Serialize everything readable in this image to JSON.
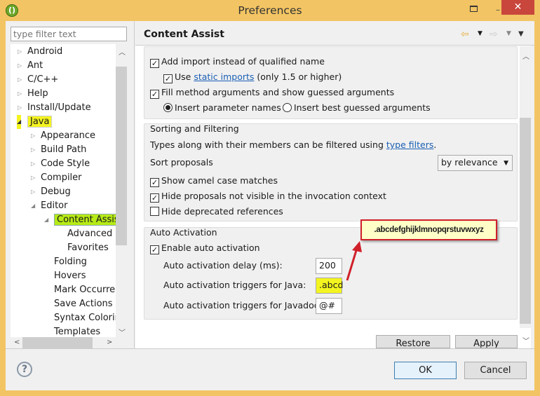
{
  "window": {
    "title": "Preferences",
    "app_icon": "eclipse-icon"
  },
  "filter": {
    "placeholder": "type filter text",
    "value": ""
  },
  "tree": {
    "items": [
      {
        "label": "Android",
        "level": 0,
        "state": "collapsed"
      },
      {
        "label": "Ant",
        "level": 0,
        "state": "collapsed"
      },
      {
        "label": "C/C++",
        "level": 0,
        "state": "collapsed"
      },
      {
        "label": "Help",
        "level": 0,
        "state": "collapsed"
      },
      {
        "label": "Install/Update",
        "level": 0,
        "state": "collapsed"
      },
      {
        "label": "Java",
        "level": 0,
        "state": "expanded",
        "highlight": "yellow"
      },
      {
        "label": "Appearance",
        "level": 1,
        "state": "collapsed"
      },
      {
        "label": "Build Path",
        "level": 1,
        "state": "collapsed"
      },
      {
        "label": "Code Style",
        "level": 1,
        "state": "collapsed"
      },
      {
        "label": "Compiler",
        "level": 1,
        "state": "collapsed"
      },
      {
        "label": "Debug",
        "level": 1,
        "state": "collapsed"
      },
      {
        "label": "Editor",
        "level": 1,
        "state": "expanded"
      },
      {
        "label": "Content Assist",
        "level": 2,
        "state": "expanded",
        "highlight": "green",
        "selected": true
      },
      {
        "label": "Advanced",
        "level": 3,
        "state": "leaf"
      },
      {
        "label": "Favorites",
        "level": 3,
        "state": "leaf"
      },
      {
        "label": "Folding",
        "level": 2,
        "state": "leaf"
      },
      {
        "label": "Hovers",
        "level": 2,
        "state": "leaf"
      },
      {
        "label": "Mark Occurren",
        "level": 2,
        "state": "leaf"
      },
      {
        "label": "Save Actions",
        "level": 2,
        "state": "leaf"
      },
      {
        "label": "Syntax Coloring",
        "level": 2,
        "state": "leaf"
      },
      {
        "label": "Templates",
        "level": 2,
        "state": "leaf"
      }
    ]
  },
  "page": {
    "title": "Content Assist",
    "insertion": {
      "add_import": {
        "label": "Add import instead of qualified name",
        "checked": true
      },
      "static_imports": {
        "pre": "Use ",
        "link": "static imports",
        "post": " (only 1.5 or higher)",
        "checked": true
      },
      "fill_args": {
        "label": "Fill method arguments and show guessed arguments",
        "checked": true
      },
      "radio_param": {
        "label": "Insert parameter names",
        "selected": true
      },
      "radio_best": {
        "label": "Insert best guessed arguments",
        "selected": false
      }
    },
    "sorting": {
      "title": "Sorting and Filtering",
      "desc_pre": "Types along with their members can be filtered using ",
      "desc_link": "type filters",
      "desc_post": ".",
      "sort_label": "Sort proposals",
      "sort_value": "by relevance",
      "camel": {
        "label": "Show camel case matches",
        "checked": true
      },
      "hide_invisible": {
        "label": "Hide proposals not visible in the invocation context",
        "checked": true
      },
      "hide_deprecated": {
        "label": "Hide deprecated references",
        "checked": false
      }
    },
    "auto": {
      "title": "Auto Activation",
      "enable": {
        "label": "Enable auto activation",
        "checked": true
      },
      "delay_label": "Auto activation delay (ms):",
      "delay_value": "200",
      "java_label": "Auto activation triggers for Java:",
      "java_value": ".abcd",
      "javadoc_label": "Auto activation triggers for Javadoc:",
      "javadoc_value": "@#"
    },
    "restore_defaults": "Restore Defaults",
    "apply": "Apply"
  },
  "annotation": {
    "callout_text": ".abcdefghijklmnopqrstuvwxyz",
    "highlight_color": "#f4f420",
    "arrow_color": "#d0202a"
  },
  "footer": {
    "ok": "OK",
    "cancel": "Cancel"
  }
}
